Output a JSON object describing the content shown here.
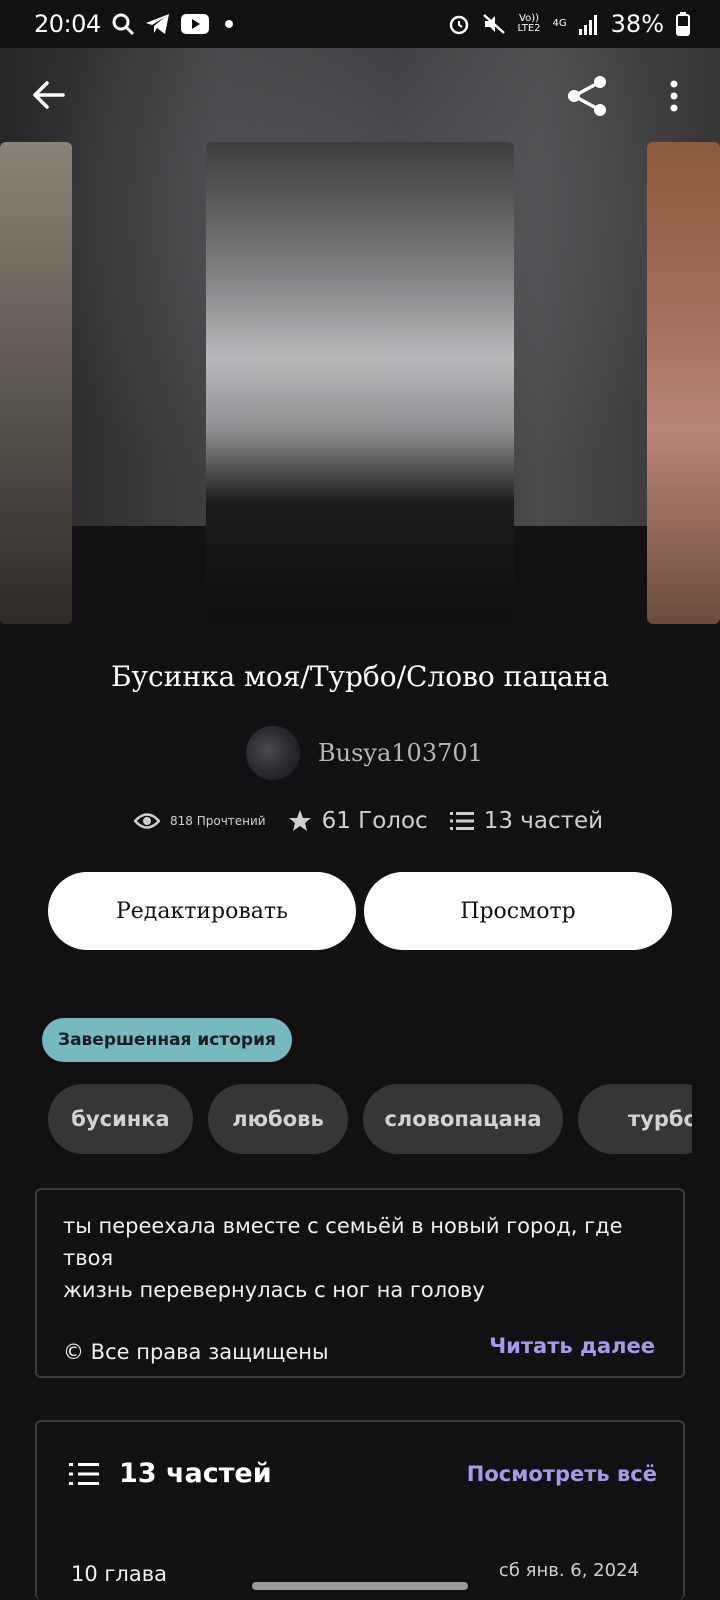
{
  "status_bar": {
    "time": "20:04",
    "network_top": "Vo))",
    "network_bottom": "LTE2",
    "signal_gen": "4G",
    "battery": "38%"
  },
  "topbar": {
    "back_icon": "arrow-left-icon",
    "share_icon": "share-icon",
    "more_icon": "more-vertical-icon"
  },
  "story": {
    "title": "Бусинка моя/Турбо/Слово пацана",
    "author": "Busya103701",
    "reads": "818 Прочтений",
    "votes": "61 Голос",
    "parts_count": "13 частей"
  },
  "buttons": {
    "edit": "Редактировать",
    "preview": "Просмотр"
  },
  "status_badge": "Завершенная история",
  "tags": [
    "бусинка",
    "любовь",
    "словопацана",
    "турбо"
  ],
  "description": {
    "line1": "ты переехала вместе с семьёй в новый город, где твоя",
    "line2": "жизнь перевернулась с ног на голову",
    "copyright": "© Все права защищены",
    "read_more": "Читать далее"
  },
  "parts": {
    "title": "13 частей",
    "see_all": "Посмотреть всё",
    "first_chapter": "10 глава",
    "first_chapter_date": "сб янв. 6, 2024"
  },
  "colors": {
    "background": "#121013",
    "accent": "#a89ae8",
    "badge": "#76b9bf"
  }
}
